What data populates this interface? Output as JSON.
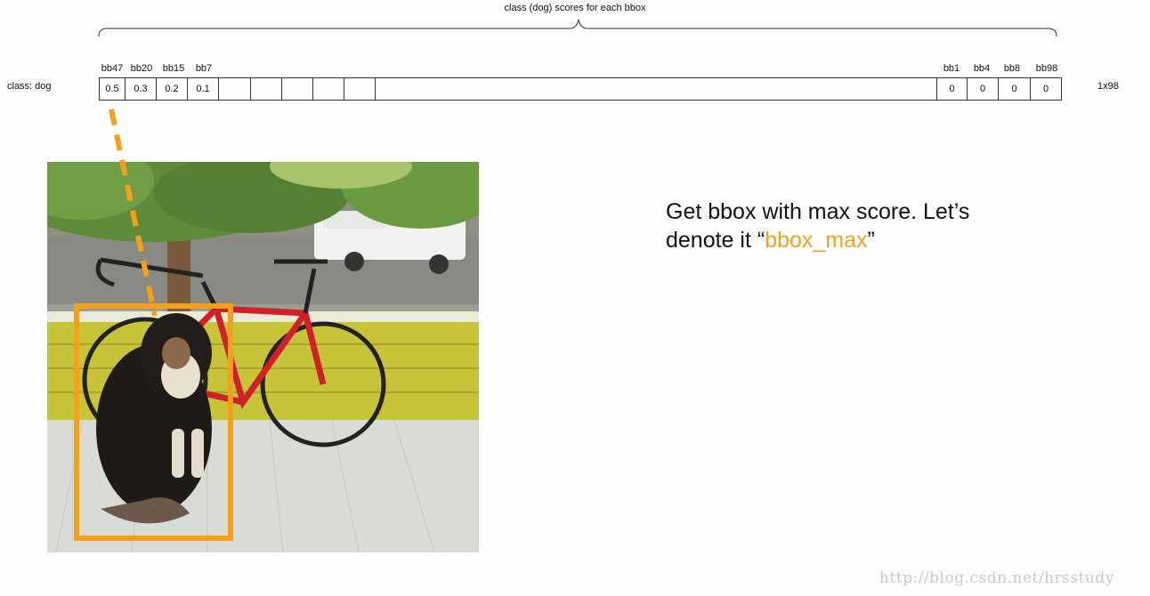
{
  "header": {
    "brace_label": "class (dog) scores for each bbox"
  },
  "row": {
    "label": "class: dog",
    "dimension": "1x98",
    "left_headers": [
      "bb47",
      "bb20",
      "bb15",
      "bb7"
    ],
    "left_values": [
      "0.5",
      "0.3",
      "0.2",
      "0.1"
    ],
    "right_headers": [
      "bb1",
      "bb4",
      "bb8",
      "bb98"
    ],
    "right_values": [
      "0",
      "0",
      "0",
      "0"
    ]
  },
  "note": {
    "line1": "Get bbox with max score. Let’s",
    "line2_prefix": "denote it “",
    "line2_highlight": "bbox_max",
    "line2_suffix": "”"
  },
  "photo": {
    "subject": "dog sitting on porch next to red bicycle, tree and white pickup truck in background"
  },
  "colors": {
    "highlight": "#f0a21c",
    "box": "#f5a01a",
    "watermark": "#c9c9c9"
  },
  "watermark": "http://blog.csdn.net/hrsstudy"
}
